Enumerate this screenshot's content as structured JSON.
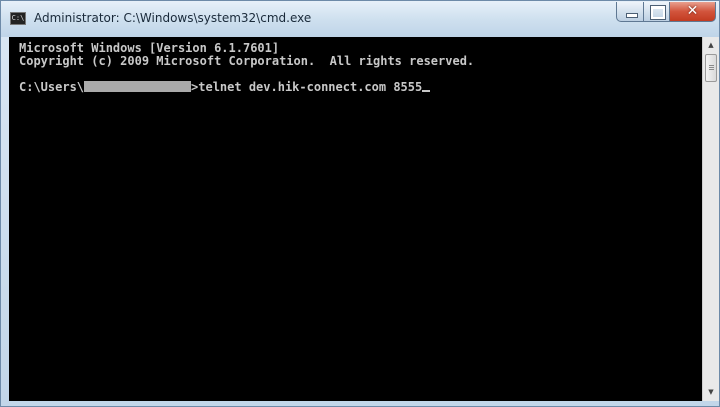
{
  "window": {
    "title": "Administrator: C:\\Windows\\system32\\cmd.exe",
    "icon": "cmd-icon",
    "buttons": {
      "minimize": "minimize-icon",
      "maximize": "maximize-icon",
      "close": "close-icon"
    },
    "close_glyph": "✕"
  },
  "console": {
    "line1": "Microsoft Windows [Version 6.1.7601]",
    "line2": "Copyright (c) 2009 Microsoft Corporation.  All rights reserved.",
    "prompt_prefix": "C:\\Users\\",
    "command": ">telnet dev.hik-connect.com 8555"
  },
  "scrollbar": {
    "up": "▲",
    "down": "▼"
  },
  "colors": {
    "console_bg": "#000000",
    "console_text": "#c8c8c8",
    "close_button": "#c8432a"
  }
}
